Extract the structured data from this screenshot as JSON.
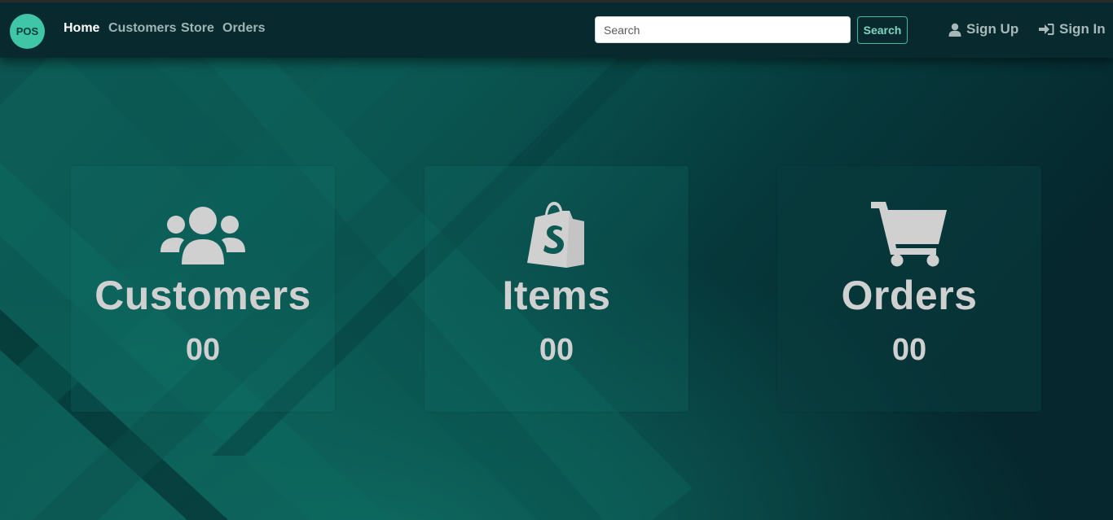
{
  "nav": {
    "logo": "POS",
    "links": [
      "Home",
      "Customers",
      "Store",
      "Orders"
    ],
    "active": "Home"
  },
  "search": {
    "placeholder": "Search",
    "value": "",
    "button": "Search"
  },
  "auth": {
    "signup": "Sign Up",
    "signin": "Sign In"
  },
  "cards": [
    {
      "title": "Customers",
      "count": "00",
      "icon": "users-icon"
    },
    {
      "title": "Items",
      "count": "00",
      "icon": "shopping-bag-icon"
    },
    {
      "title": "Orders",
      "count": "00",
      "icon": "cart-icon"
    }
  ],
  "colors": {
    "accent": "#3fc6a7",
    "navbar": "#082a2e",
    "card_text": "#d0d0d0"
  }
}
